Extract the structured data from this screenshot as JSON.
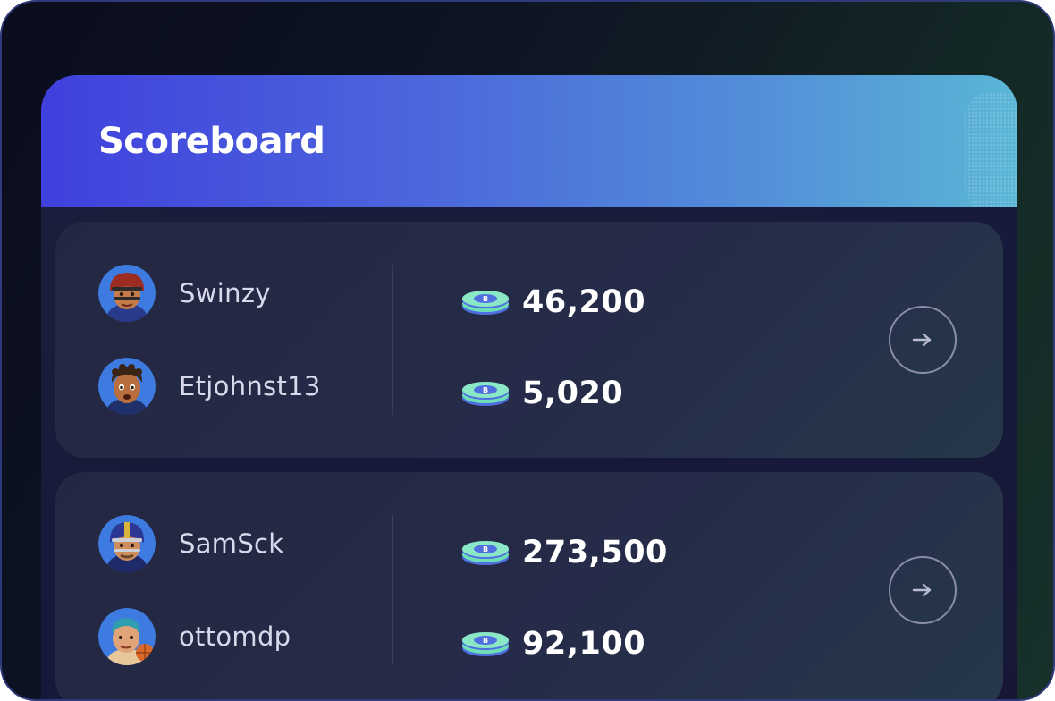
{
  "scoreboard": {
    "title": "Scoreboard",
    "matches": [
      {
        "players": [
          {
            "name": "Swinzy",
            "score": "46,200",
            "avatar": "avatar-helmet-red"
          },
          {
            "name": "Etjohnst13",
            "score": "5,020",
            "avatar": "avatar-curly-hair"
          }
        ],
        "action_icon": "arrow-right-icon"
      },
      {
        "players": [
          {
            "name": "SamSck",
            "score": "273,500",
            "avatar": "avatar-helmet-blue"
          },
          {
            "name": "ottomdp",
            "score": "92,100",
            "avatar": "avatar-cap-basketball"
          }
        ],
        "action_icon": "arrow-right-icon"
      }
    ]
  },
  "colors": {
    "header_gradient_start": "#4040dd",
    "header_gradient_end": "#5ab6d6",
    "chip_green": "#6fe0b6",
    "chip_blue": "#4f6fe0",
    "card_bg": "#1b1e3b",
    "row_bg": "#252b48"
  }
}
